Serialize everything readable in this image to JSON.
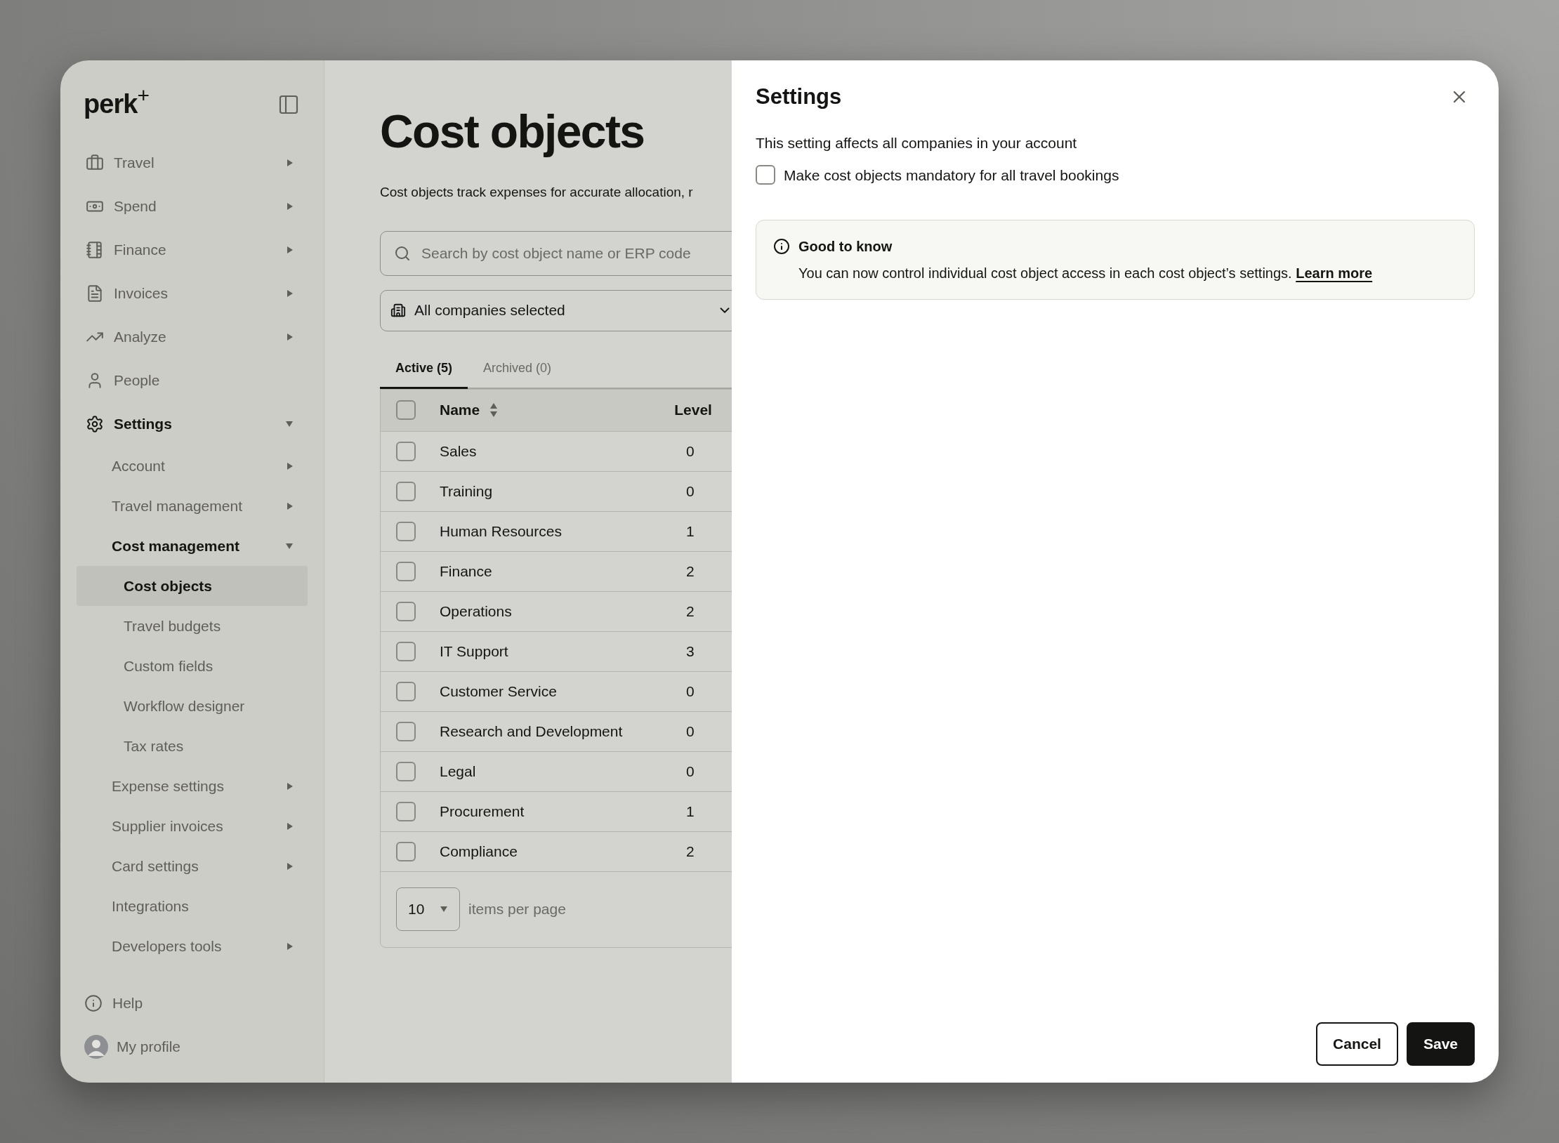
{
  "sidebar": {
    "logo": "perk",
    "logo_mark": "+",
    "items": [
      {
        "label": "Travel",
        "kind": "group",
        "expanded": false,
        "selected": false
      },
      {
        "label": "Spend",
        "kind": "group",
        "expanded": false,
        "selected": false
      },
      {
        "label": "Finance",
        "kind": "group",
        "expanded": false,
        "selected": false
      },
      {
        "label": "Invoices",
        "kind": "group",
        "expanded": false,
        "selected": false
      },
      {
        "label": "Analyze",
        "kind": "group",
        "expanded": false,
        "selected": false
      },
      {
        "label": "People",
        "kind": "link",
        "selected": false
      },
      {
        "label": "Settings",
        "kind": "group",
        "expanded": true,
        "selected": true,
        "children": [
          {
            "label": "Account",
            "kind": "group",
            "expanded": false,
            "selected": false
          },
          {
            "label": "Travel management",
            "kind": "group",
            "expanded": false,
            "selected": false
          },
          {
            "label": "Cost management",
            "kind": "group",
            "expanded": true,
            "selected": true,
            "children": [
              {
                "label": "Cost objects",
                "kind": "link",
                "selected": true
              },
              {
                "label": "Travel budgets",
                "kind": "link",
                "selected": false
              },
              {
                "label": "Custom fields",
                "kind": "link",
                "selected": false
              },
              {
                "label": "Workflow designer",
                "kind": "link",
                "selected": false
              },
              {
                "label": "Tax rates",
                "kind": "link",
                "selected": false
              }
            ]
          },
          {
            "label": "Expense settings",
            "kind": "group",
            "expanded": false,
            "selected": false
          },
          {
            "label": "Supplier invoices",
            "kind": "group",
            "expanded": false,
            "selected": false
          },
          {
            "label": "Card settings",
            "kind": "group",
            "expanded": false,
            "selected": false
          },
          {
            "label": "Integrations",
            "kind": "link",
            "selected": false
          },
          {
            "label": "Developers tools",
            "kind": "group",
            "expanded": false,
            "selected": false
          }
        ]
      }
    ],
    "footer": [
      {
        "label": "Help",
        "kind": "help"
      },
      {
        "label": "My profile",
        "kind": "profile"
      }
    ]
  },
  "page": {
    "title": "Cost objects",
    "description": "Cost objects track expenses for accurate allocation, r",
    "search": {
      "placeholder": "Search by cost object name or ERP code"
    },
    "company_filter": {
      "value": "All companies selected"
    },
    "tabs": [
      {
        "label": "Active (5)",
        "selected": true
      },
      {
        "label": "Archived (0)",
        "selected": false
      }
    ],
    "table": {
      "all_checked": false,
      "columns": [
        "Name",
        "Level"
      ],
      "rows": [
        {
          "name": "Sales",
          "level": "0",
          "checked": false
        },
        {
          "name": "Training",
          "level": "0",
          "checked": false
        },
        {
          "name": "Human Resources",
          "level": "1",
          "checked": false
        },
        {
          "name": "Finance",
          "level": "2",
          "checked": false
        },
        {
          "name": "Operations",
          "level": "2",
          "checked": false
        },
        {
          "name": "IT Support",
          "level": "3",
          "checked": false
        },
        {
          "name": "Customer Service",
          "level": "0",
          "checked": false
        },
        {
          "name": "Research and Development",
          "level": "0",
          "checked": false
        },
        {
          "name": "Legal",
          "level": "0",
          "checked": false
        },
        {
          "name": "Procurement",
          "level": "1",
          "checked": false
        },
        {
          "name": "Compliance",
          "level": "2",
          "checked": false
        }
      ]
    },
    "pagination": {
      "per_page": "10",
      "label": "items per page"
    }
  },
  "dialog": {
    "title": "Settings",
    "note": "This setting affects all companies in your account",
    "mandatory": {
      "label": "Make cost objects mandatory for all travel bookings",
      "checked": false
    },
    "info": {
      "title": "Good to know",
      "text": "You can now control individual cost object access in each cost object’s settings.",
      "link": "Learn more"
    },
    "buttons": [
      {
        "label": "Cancel",
        "kind": "secondary"
      },
      {
        "label": "Save",
        "kind": "primary"
      }
    ]
  }
}
